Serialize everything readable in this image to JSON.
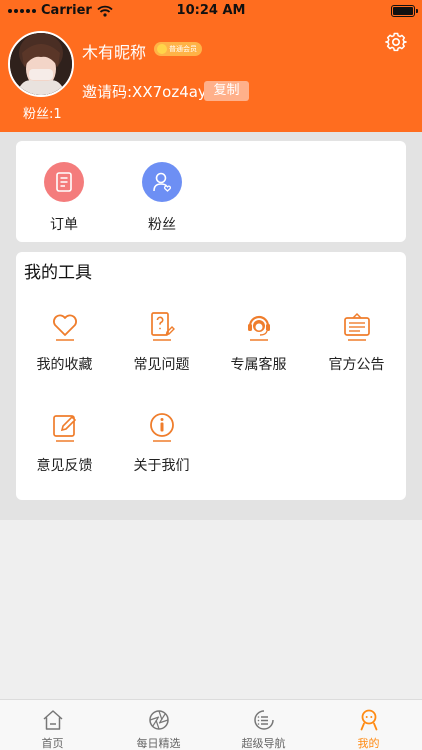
{
  "status_bar": {
    "carrier": "Carrier",
    "time": "10:24 AM"
  },
  "profile": {
    "nickname": "木有昵称",
    "level_badge": "普通会员",
    "invite_code": "邀请码:XX7oz4ay",
    "copy_label": "复制",
    "fans_count": "粉丝:1"
  },
  "quick_links": [
    {
      "label": "订单",
      "icon": "order-icon",
      "color": "#f47c7c"
    },
    {
      "label": "粉丝",
      "icon": "fans-icon",
      "color": "#6d8ff4"
    }
  ],
  "tools": {
    "title": "我的工具",
    "items": [
      {
        "label": "我的收藏",
        "icon": "heart-icon"
      },
      {
        "label": "常见问题",
        "icon": "faq-icon"
      },
      {
        "label": "专属客服",
        "icon": "customer-service-icon"
      },
      {
        "label": "官方公告",
        "icon": "announcement-icon"
      },
      {
        "label": "意见反馈",
        "icon": "feedback-icon"
      },
      {
        "label": "关于我们",
        "icon": "info-icon"
      }
    ]
  },
  "tab_bar": [
    {
      "label": "首页",
      "icon": "home-icon",
      "active": false
    },
    {
      "label": "每日精选",
      "icon": "aperture-icon",
      "active": false
    },
    {
      "label": "超级导航",
      "icon": "list-icon",
      "active": false
    },
    {
      "label": "我的",
      "icon": "mine-icon",
      "active": true
    }
  ],
  "colors": {
    "brand": "#ff6d1f",
    "accent": "#ff8a12",
    "order_icon": "#f47c7c",
    "fans_icon": "#6d8ff4"
  }
}
